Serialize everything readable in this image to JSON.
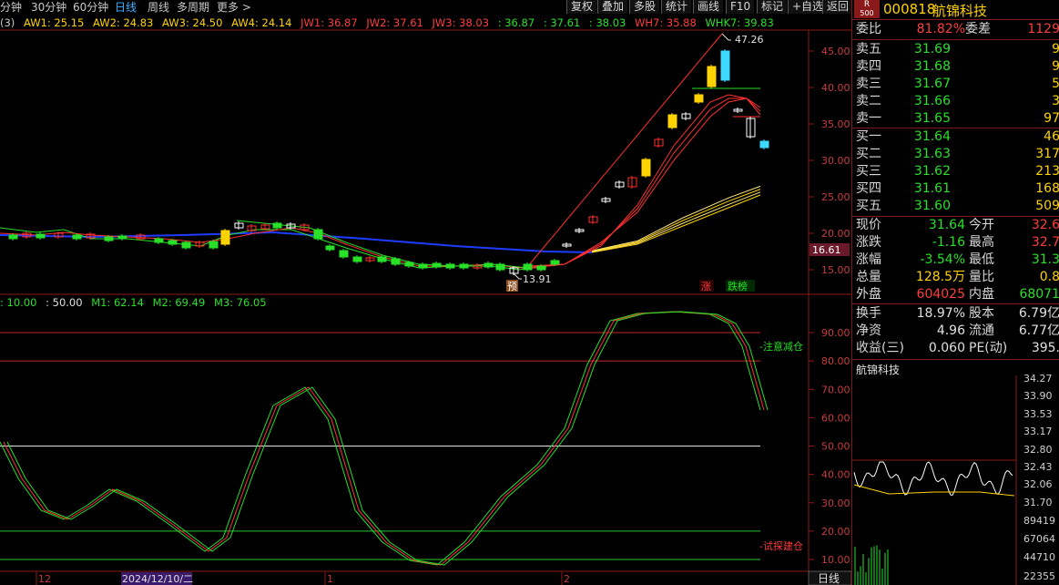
{
  "topbar": {
    "periods": [
      "分钟",
      "30分钟",
      "60分钟",
      "日线",
      "周线",
      "多周期",
      "更多 >"
    ],
    "active_index": 3,
    "buttons": [
      "复权",
      "叠加",
      "多股",
      "统计",
      "画线",
      "F10",
      "标记",
      "+自选",
      "返回"
    ]
  },
  "main_legend": {
    "prefix": "(3)",
    "items": [
      {
        "text": "AW1: 25.15",
        "color": "#ffd200"
      },
      {
        "text": "AW2: 24.83",
        "color": "#ffd200"
      },
      {
        "text": "AW3: 24.50",
        "color": "#ffd200"
      },
      {
        "text": "AW4: 24.14",
        "color": "#ffd200"
      },
      {
        "text": "JW1: 36.87",
        "color": "#ff3c3c"
      },
      {
        "text": "JW2: 37.61",
        "color": "#ff3c3c"
      },
      {
        "text": "JW3: 38.03",
        "color": "#ff3c3c"
      },
      {
        "text": ": 36.87",
        "color": "#28e028"
      },
      {
        "text": ": 37.61",
        "color": "#28e028"
      },
      {
        "text": ": 38.03",
        "color": "#28e028"
      },
      {
        "text": "WH7: 35.88",
        "color": "#ff3c3c"
      },
      {
        "text": "WHK7: 39.83",
        "color": "#28e028"
      }
    ]
  },
  "sub_legend": {
    "items": [
      {
        "text": ": 10.00",
        "color": "#28e028"
      },
      {
        "text": ": 50.00",
        "color": "#e0e0e0"
      },
      {
        "text": "M1: 62.14",
        "color": "#28e028"
      },
      {
        "text": "M2: 69.49",
        "color": "#28e028"
      },
      {
        "text": "M3: 76.05",
        "color": "#28e028"
      }
    ]
  },
  "main_axis": [
    "45.00",
    "40.00",
    "35.00",
    "30.00",
    "25.00",
    "20.00",
    "15.00"
  ],
  "main_axis_values": [
    45,
    40,
    35,
    30,
    25,
    20,
    15
  ],
  "current_price_tag": "16.61",
  "sub_axis": [
    "90.00",
    "80.00",
    "70.00",
    "60.00",
    "50.00",
    "40.00",
    "30.00",
    "20.00",
    "10.00"
  ],
  "sub_axis_values": [
    90,
    80,
    70,
    60,
    50,
    40,
    30,
    20,
    10
  ],
  "annotations": {
    "high": "47.26",
    "low": "13.91",
    "pre_label": "预",
    "zhang": "涨",
    "diebang": "跌榜",
    "top_note": "-注意减仓",
    "bottom_note": "-试探建仓"
  },
  "date_axis": {
    "labels": [
      "12",
      "2024/12/10/二",
      "1",
      "2"
    ],
    "period_button": "日线"
  },
  "quote": {
    "header_badge_top": "R",
    "header_badge_bottom": "500",
    "code": "000818",
    "name": "航锦科技",
    "weibi_label": "委比",
    "weibi_value": "81.82%",
    "weicha_label": "委差",
    "weicha_value": "1129",
    "sells": [
      {
        "label": "卖五",
        "price": "31.69",
        "vol": "9"
      },
      {
        "label": "卖四",
        "price": "31.68",
        "vol": "9"
      },
      {
        "label": "卖三",
        "price": "31.67",
        "vol": "5"
      },
      {
        "label": "卖二",
        "price": "31.66",
        "vol": "3"
      },
      {
        "label": "卖一",
        "price": "31.65",
        "vol": "97"
      }
    ],
    "buys": [
      {
        "label": "买一",
        "price": "31.64",
        "vol": "46"
      },
      {
        "label": "买二",
        "price": "31.63",
        "vol": "317"
      },
      {
        "label": "买三",
        "price": "31.62",
        "vol": "213"
      },
      {
        "label": "买四",
        "price": "31.61",
        "vol": "168"
      },
      {
        "label": "买五",
        "price": "31.60",
        "vol": "509"
      }
    ],
    "stats": [
      {
        "l1": "现价",
        "v1": "31.64",
        "c1": "g",
        "l2": "今开",
        "v2": "32.6",
        "c2": "r"
      },
      {
        "l1": "涨跌",
        "v1": "-1.16",
        "c1": "g",
        "l2": "最高",
        "v2": "32.7",
        "c2": "r"
      },
      {
        "l1": "涨幅",
        "v1": "-3.54%",
        "c1": "g",
        "l2": "最低",
        "v2": "31.3",
        "c2": "g"
      },
      {
        "l1": "总量",
        "v1": "128.5万",
        "c1": "y",
        "l2": "量比",
        "v2": "0.8",
        "c2": "y"
      },
      {
        "l1": "外盘",
        "v1": "604025",
        "c1": "r",
        "l2": "内盘",
        "v2": "68071",
        "c2": "g"
      }
    ],
    "stats2": [
      {
        "l1": "换手",
        "v1": "18.97%",
        "l2": "股本",
        "v2": "6.79亿"
      },
      {
        "l1": "净资",
        "v1": "4.96",
        "l2": "流通",
        "v2": "6.77亿"
      },
      {
        "l1": "收益(三)",
        "v1": "0.060",
        "l2": "PE(动)",
        "v2": "395."
      }
    ],
    "mini_title": "航锦科技",
    "mini_axis": [
      "34.27",
      "33.90",
      "33.53",
      "33.17",
      "32.80",
      "32.43",
      "32.06",
      "31.70",
      "89419",
      "67064",
      "44710",
      "22355"
    ]
  },
  "colors": {
    "up": "#ff3c3c",
    "down": "#28e028",
    "line_blue": "#1e3cff",
    "yellow": "#ffd200",
    "frame": "#8c1a1a"
  }
}
